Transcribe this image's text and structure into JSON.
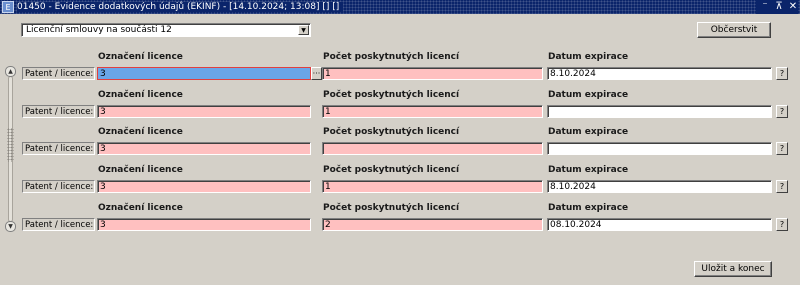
{
  "window": {
    "icon_glyph": "E",
    "title": "01450 - Evidence dodatkových údajů (EKINF) - [14.10.2024; 13:08] [] []",
    "buttons": {
      "minimize": "⁻",
      "restore": "⊼",
      "close": "✕"
    }
  },
  "filter": {
    "selected": "Licenční smlouvy na součásti 12",
    "arrow": "▼"
  },
  "toolbar": {
    "refresh_label": "Občerstvit",
    "save_close_label": "Uložit a konec"
  },
  "scrollbar": {
    "up": "▲",
    "down": "▼"
  },
  "columns": {
    "license": "Označení licence",
    "count": "Počet poskytnutých licencí",
    "expiration": "Datum expirace"
  },
  "row_label": "Patent / licence:",
  "help_label": "?",
  "dots_label": "···",
  "rows": [
    {
      "license": "3",
      "count": "1",
      "expiration": "8.10.2024"
    },
    {
      "license": "3",
      "count": "1",
      "expiration": ""
    },
    {
      "license": "3",
      "count": "",
      "expiration": ""
    },
    {
      "license": "3",
      "count": "1",
      "expiration": "8.10.2024"
    },
    {
      "license": "3",
      "count": "2",
      "expiration": "08.10.2024"
    }
  ]
}
